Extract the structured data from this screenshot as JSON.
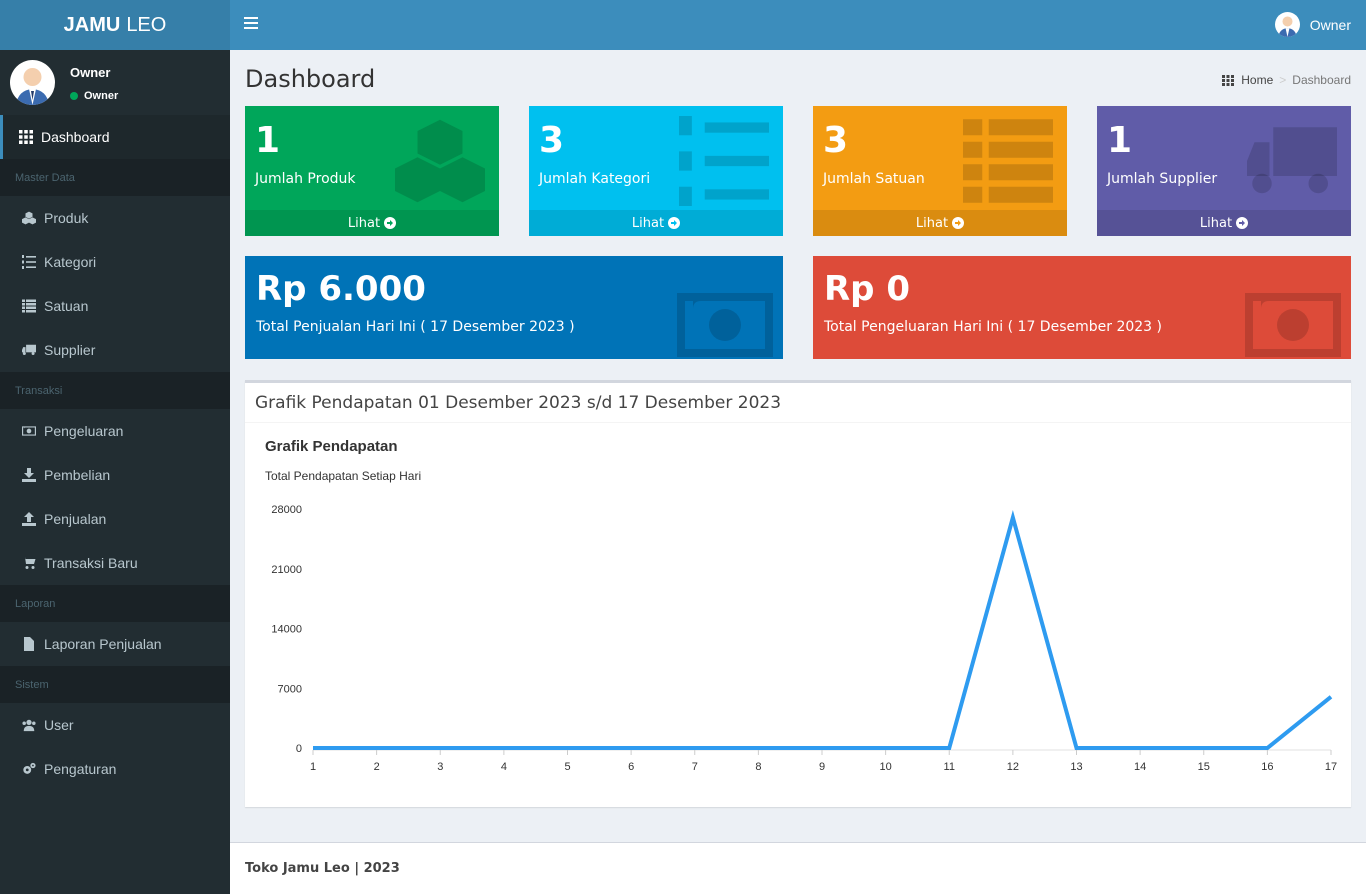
{
  "app": {
    "logo_bold": "JAMU",
    "logo_light": "LEO"
  },
  "navbar": {
    "user_name": "Owner"
  },
  "sidebar": {
    "user_name": "Owner",
    "user_status": "Owner",
    "items": [
      {
        "type": "item",
        "label": "Dashboard",
        "icon": "grid-icon",
        "active": true
      },
      {
        "type": "header",
        "label": "Master Data"
      },
      {
        "type": "item",
        "label": "Produk",
        "icon": "cubes-icon"
      },
      {
        "type": "item",
        "label": "Kategori",
        "icon": "list-ol-icon"
      },
      {
        "type": "item",
        "label": "Satuan",
        "icon": "list-icon"
      },
      {
        "type": "item",
        "label": "Supplier",
        "icon": "truck-icon"
      },
      {
        "type": "header",
        "label": "Transaksi"
      },
      {
        "type": "item",
        "label": "Pengeluaran",
        "icon": "money-icon"
      },
      {
        "type": "item",
        "label": "Pembelian",
        "icon": "download-icon"
      },
      {
        "type": "item",
        "label": "Penjualan",
        "icon": "upload-icon"
      },
      {
        "type": "item",
        "label": "Transaksi Baru",
        "icon": "cart-icon"
      },
      {
        "type": "header",
        "label": "Laporan"
      },
      {
        "type": "item",
        "label": "Laporan Penjualan",
        "icon": "file-icon"
      },
      {
        "type": "header",
        "label": "Sistem"
      },
      {
        "type": "item",
        "label": "User",
        "icon": "users-icon"
      },
      {
        "type": "item",
        "label": "Pengaturan",
        "icon": "cogs-icon"
      }
    ]
  },
  "header": {
    "title": "Dashboard",
    "breadcrumb_home": "Home",
    "breadcrumb_current": "Dashboard"
  },
  "stats": [
    {
      "value": "1",
      "label": "Jumlah Produk",
      "more": "Lihat",
      "color": "#00a65a",
      "icon": "cubes-icon"
    },
    {
      "value": "3",
      "label": "Jumlah Kategori",
      "more": "Lihat",
      "color": "#00c0ef",
      "icon": "list-ol-icon"
    },
    {
      "value": "3",
      "label": "Jumlah Satuan",
      "more": "Lihat",
      "color": "#f39c12",
      "icon": "list-icon"
    },
    {
      "value": "1",
      "label": "Jumlah Supplier",
      "more": "Lihat",
      "color": "#605ca8",
      "icon": "truck-icon"
    }
  ],
  "totals": [
    {
      "value": "Rp 6.000",
      "label": "Total Penjualan Hari Ini ( 17 Desember 2023 )",
      "color": "#0073b7",
      "icon": "money-icon"
    },
    {
      "value": "Rp 0",
      "label": "Total Pengeluaran Hari Ini ( 17 Desember 2023 )",
      "color": "#dd4b39",
      "icon": "money-icon"
    }
  ],
  "chart_box": {
    "title": "Grafik Pendapatan 01 Desember 2023 s/d 17 Desember 2023"
  },
  "chart_data": {
    "type": "line",
    "title": "Grafik Pendapatan",
    "subtitle": "Total Pendapatan Setiap Hari",
    "x": [
      1,
      2,
      3,
      4,
      5,
      6,
      7,
      8,
      9,
      10,
      11,
      12,
      13,
      14,
      15,
      16,
      17
    ],
    "series": [
      {
        "values": [
          0,
          0,
          0,
          0,
          0,
          0,
          0,
          0,
          0,
          0,
          0,
          27000,
          0,
          0,
          0,
          0,
          6000
        ],
        "color": "#2e9bf0"
      }
    ],
    "ylim": [
      0,
      28000
    ],
    "yticks": [
      0,
      7000,
      14000,
      21000,
      28000
    ],
    "grid": false
  },
  "footer": {
    "text": "Toko Jamu Leo | 2023"
  }
}
